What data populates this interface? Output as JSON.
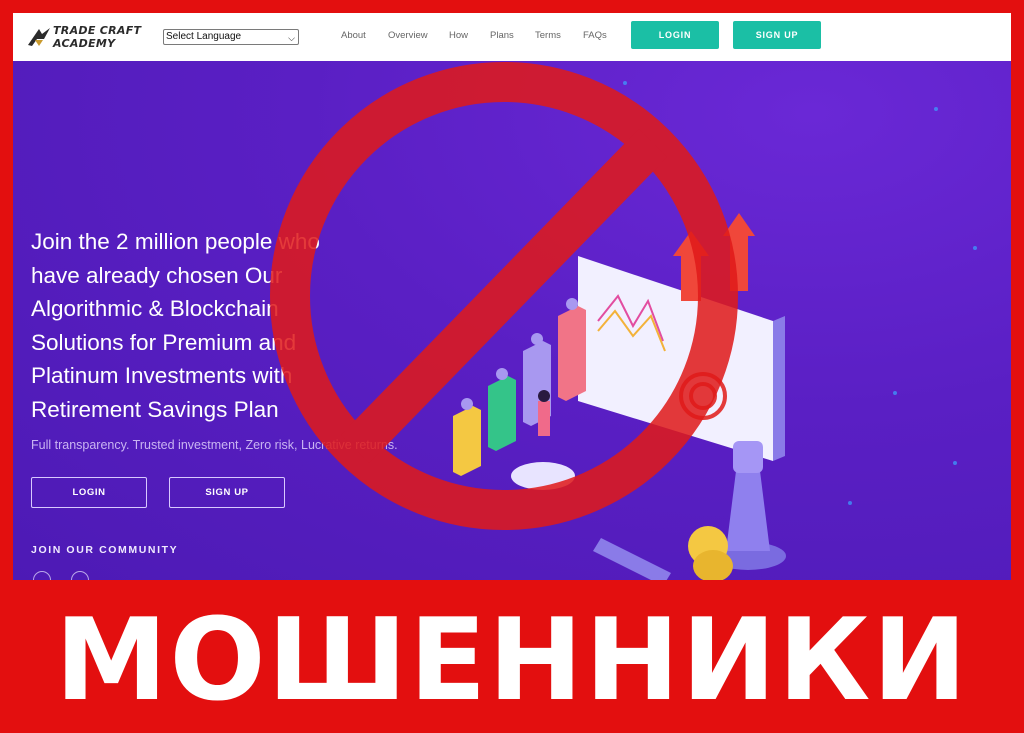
{
  "header": {
    "logo_line1": "TRADE CRAFT",
    "logo_line2": "ACADEMY",
    "language_select": "Select Language",
    "nav": [
      "About",
      "Overview",
      "How",
      "Plans",
      "Terms",
      "FAQs"
    ],
    "login_label": "LOGIN",
    "signup_label": "SIGN UP"
  },
  "hero": {
    "headline_lines": [
      "Join the 2 million people who",
      "have already chosen Our",
      "Algorithmic & Blockchain",
      "Solutions for Premium and",
      "Platinum Investments with",
      "Retirement Savings Plan"
    ],
    "tagline": "Full transparency. Trusted investment, Zero risk, Lucrative returns.",
    "login_label": "LOGIN",
    "signup_label": "SIGN UP",
    "community_label": "JOIN OUR COMMUNITY"
  },
  "overlay": {
    "caption": "МОШЕННИКИ",
    "prohibition_icon": "no-entry-icon"
  },
  "colors": {
    "frame_red": "#e30f0f",
    "hero_purple": "#5a1fc4",
    "accent_teal": "#1bbfa5"
  }
}
